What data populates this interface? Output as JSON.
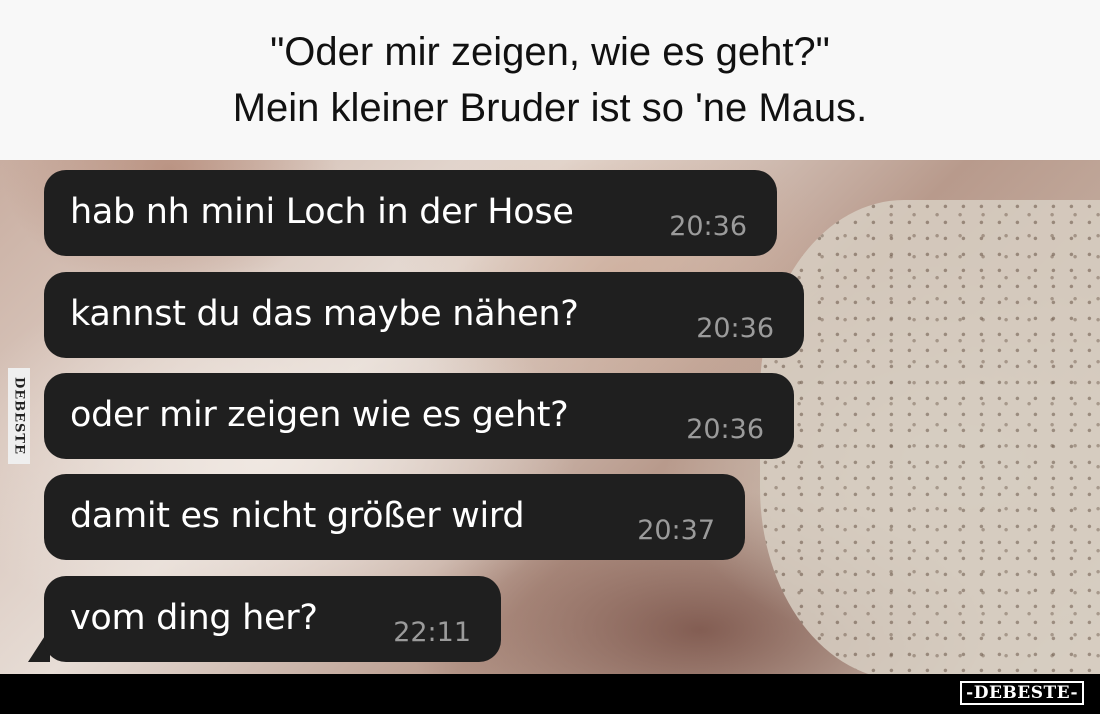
{
  "caption": {
    "line1": "\"Oder mir zeigen, wie es geht?\"",
    "line2": "Mein kleiner Bruder ist so 'ne Maus."
  },
  "chat": {
    "messages": [
      {
        "text": "hab nh mini Loch in der Hose",
        "time": "20:36"
      },
      {
        "text": "kannst du das maybe nähen?",
        "time": "20:36"
      },
      {
        "text": "oder mir zeigen wie es geht?",
        "time": "20:36"
      },
      {
        "text": "damit es nicht größer wird",
        "time": "20:37"
      },
      {
        "text": "vom ding her?",
        "time": "22:11"
      }
    ]
  },
  "watermark": {
    "side_label": "DEBESTE",
    "logo_text": "-DEBESTE-"
  },
  "colors": {
    "bubble_bg": "#1f1f1f",
    "time_text": "#9b9b9b",
    "caption_bg": "#f8f8f8"
  }
}
